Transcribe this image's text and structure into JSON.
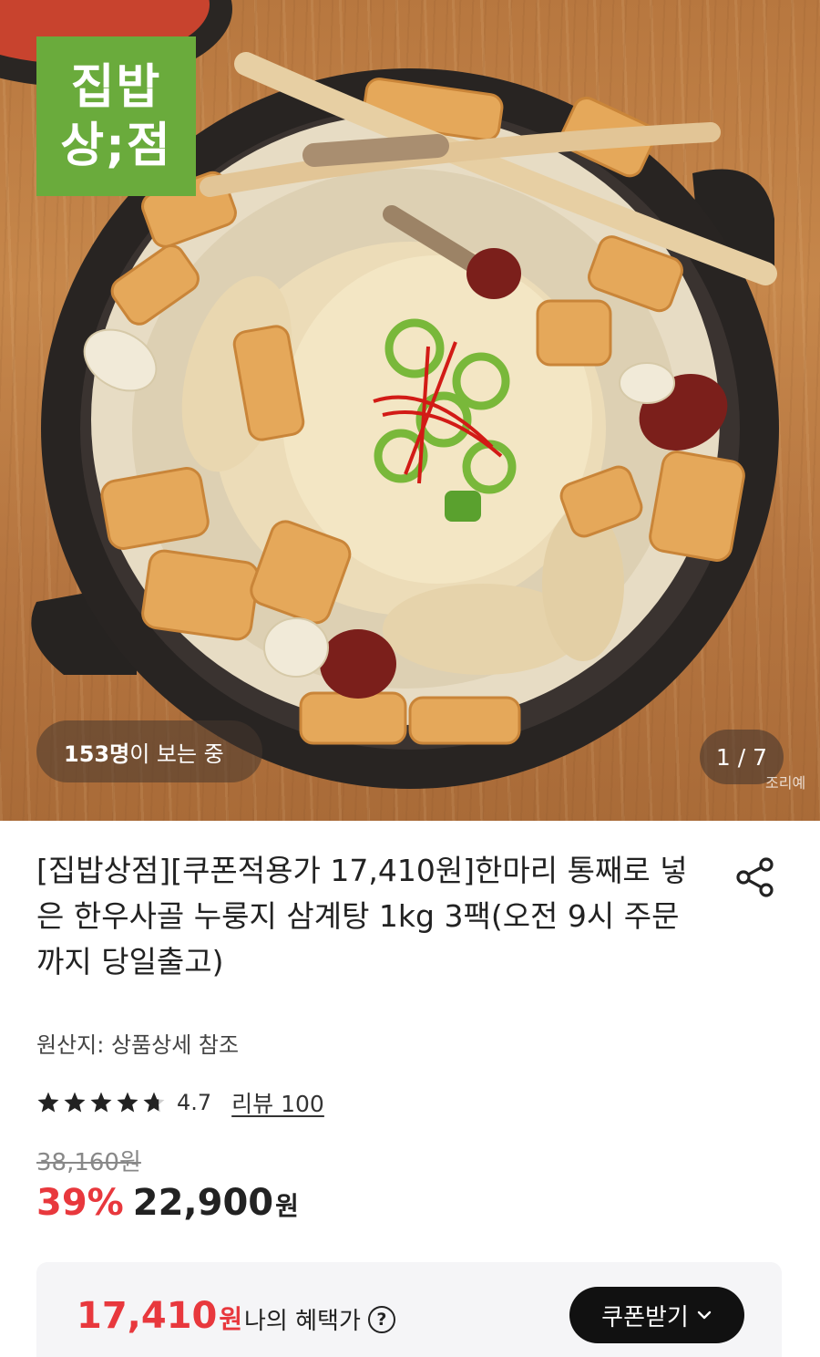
{
  "hero": {
    "brand_logo_line1": "집밥",
    "brand_logo_line2": "상;점",
    "viewers_count": "153명",
    "viewers_suffix": "이 보는 중",
    "image_counter": "1 / 7",
    "watermark": "조리예"
  },
  "product": {
    "title": "[집밥상점][쿠폰적용가 17,410원]한마리 통째로 넣은 한우사골 누룽지 삼계탕 1kg 3팩(오전 9시 주문까지 당일출고)",
    "origin": "원산지: 상품상세 참조",
    "rating": "4.7",
    "rating_fraction": 0.94,
    "review_link": "리뷰 100",
    "original_price": "38,160원",
    "discount": "39%",
    "sale_price": "22,900",
    "sale_unit": "원"
  },
  "benefit": {
    "price": "17,410",
    "unit": "원",
    "label": "나의 혜택가",
    "help_icon_glyph": "?",
    "coupon_button": "쿠폰받기"
  },
  "colors": {
    "accent_red": "#e8383d",
    "logo_green": "#6aab3c",
    "button_black": "#111111"
  },
  "icons": [
    "share-icon",
    "star-icon",
    "question-circle-icon",
    "chevron-down-icon"
  ]
}
